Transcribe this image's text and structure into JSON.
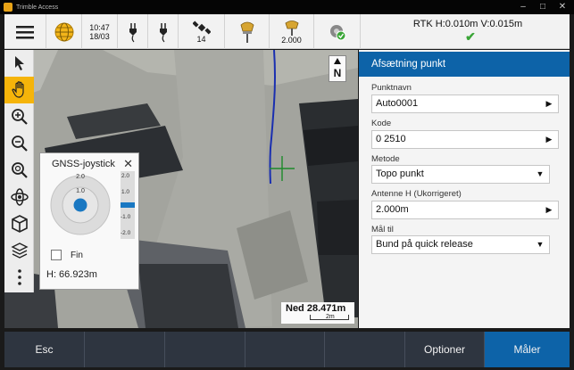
{
  "window": {
    "title": "Trimble Access"
  },
  "status": {
    "menu_icon": "hamburger-icon",
    "time": "10:47",
    "date": "18/03",
    "satellites": "14",
    "antenna_height": "2.000",
    "rtk_text": "RTK H:0.010m V:0.015m"
  },
  "map": {
    "north_label": "N",
    "scale_text": "Ned 28.471m",
    "scale_bar_label": "2m"
  },
  "joystick": {
    "title": "GNSS-joystick",
    "ring_outer": "2.0",
    "ring_inner": "1.0",
    "scale_labels": [
      "2.0",
      "1.0",
      "-1.0",
      "-2.0"
    ],
    "fine_label": "Fin",
    "height_text": "H: 66.923m"
  },
  "panel": {
    "title": "Afsætning punkt",
    "fields": [
      {
        "label": "Punktnavn",
        "value": "Auto0001",
        "type": "arrow"
      },
      {
        "label": "Kode",
        "value": "0 2510",
        "type": "arrow"
      },
      {
        "label": "Metode",
        "value": "Topo punkt",
        "type": "dropdown"
      },
      {
        "label": "Antenne H (Ukorrigeret)",
        "value": "2.000m",
        "type": "arrow"
      },
      {
        "label": "Mål til",
        "value": "Bund på quick release",
        "type": "dropdown"
      }
    ]
  },
  "bottom": {
    "esc": "Esc",
    "options": "Optioner",
    "measure": "Måler"
  },
  "colors": {
    "accent": "#0d63a8",
    "tool_active": "#f5b40a",
    "bottom_bar": "#2e3540",
    "rtk_ok": "#3aa537"
  }
}
